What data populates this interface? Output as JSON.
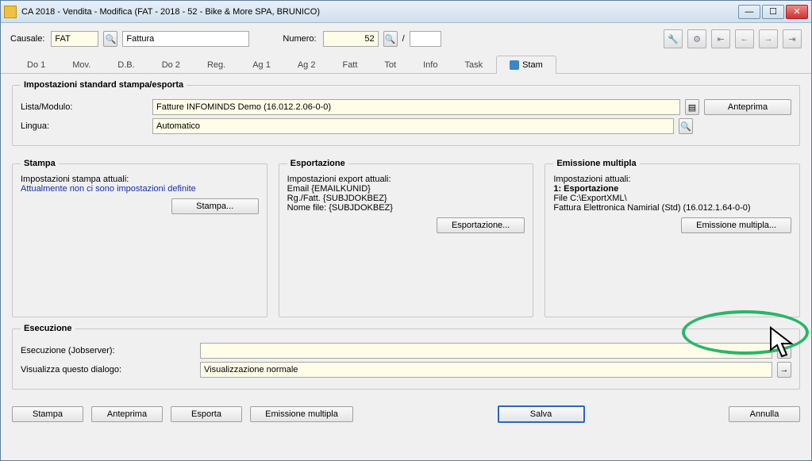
{
  "window": {
    "title": "CA 2018 - Vendita - Modifica (FAT - 2018 - 52 - Bike & More SPA, BRUNICO)"
  },
  "top": {
    "causale_label": "Causale:",
    "causale_value": "FAT",
    "causale_desc": "Fattura",
    "numero_label": "Numero:",
    "numero_value": "52",
    "slash": "/"
  },
  "tabs": [
    "Do 1",
    "Mov.",
    "D.B.",
    "Do 2",
    "Reg.",
    "Ag 1",
    "Ag 2",
    "Fatt",
    "Tot",
    "Info",
    "Task",
    "Stam"
  ],
  "active_tab": 11,
  "group1": {
    "legend": "Impostazioni standard stampa/esporta",
    "lista_label": "Lista/Modulo:",
    "lista_value": "Fatture INFOMINDS Demo (16.012.2.06-0-0)",
    "anteprima": "Anteprima",
    "lingua_label": "Lingua:",
    "lingua_value": "Automatico"
  },
  "stampa": {
    "legend": "Stampa",
    "line1": "Impostazioni stampa attuali:",
    "line2": "Attualmente non ci sono impostazioni definite",
    "btn": "Stampa..."
  },
  "esport": {
    "legend": "Esportazione",
    "line1": "Impostazioni export attuali:",
    "line2": "Email  {EMAILKUNID}",
    "line3": "Rg./Fatt. {SUBJDOKBEZ}",
    "line4": "Nome file: {SUBJDOKBEZ}",
    "btn": "Esportazione..."
  },
  "emiss": {
    "legend": "Emissione multipla",
    "line1": "Impostazioni attuali:",
    "line2": "1: Esportazione",
    "line3": "File  C:\\ExportXML\\",
    "line4": "Fattura Elettronica Namirial (Std) (16.012.1.64-0-0)",
    "btn": "Emissione multipla..."
  },
  "esec": {
    "legend": "Esecuzione",
    "jobserver_label": "Esecuzione (Jobserver):",
    "jobserver_value": "",
    "dialog_label": "Visualizza questo dialogo:",
    "dialog_value": "Visualizzazione normale"
  },
  "footer": {
    "stampa": "Stampa",
    "anteprima": "Anteprima",
    "esporta": "Esporta",
    "emissione": "Emissione multipla",
    "salva": "Salva",
    "annulla": "Annulla"
  }
}
